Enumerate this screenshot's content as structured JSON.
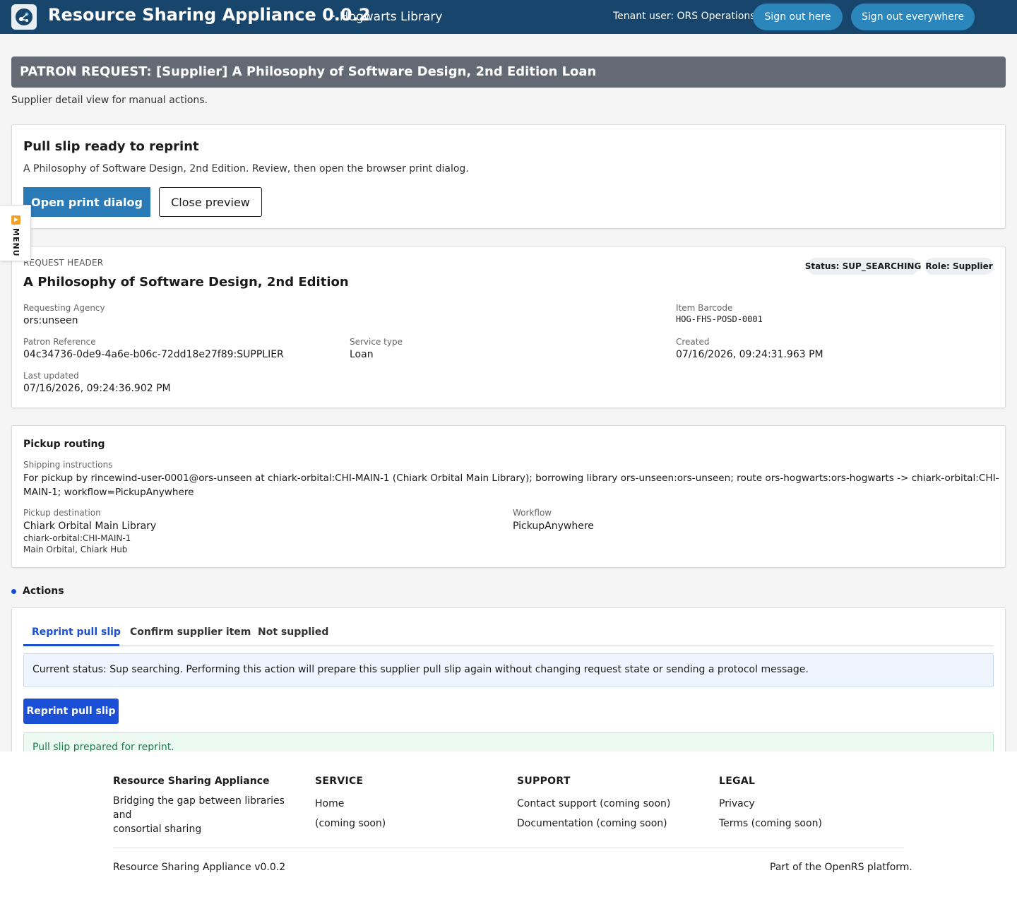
{
  "header": {
    "app_title": "Resource Sharing Appliance 0.0.2",
    "app_subtitle": "· Hogwarts Library",
    "tenant_user": "Tenant user: ORS Operations",
    "sign_out_here": "Sign out here",
    "sign_out_everywhere": "Sign out everywhere",
    "logo_icon": "share-nodes-icon"
  },
  "side_menu": {
    "label": "MENU",
    "icon": "play-icon"
  },
  "page": {
    "title": "PATRON REQUEST: [Supplier] A Philosophy of Software Design, 2nd Edition Loan",
    "subtitle": "Supplier detail view for manual actions."
  },
  "print_card": {
    "heading": "Pull slip ready to reprint",
    "description": "A Philosophy of Software Design, 2nd Edition. Review, then open the browser print dialog.",
    "open_print": "Open print dialog",
    "close_preview": "Close preview"
  },
  "request_header": {
    "kicker": "REQUEST HEADER",
    "title": "A Philosophy of Software Design, 2nd Edition",
    "status_badge": "Status: SUP_SEARCHING",
    "role_badge": "Role: Supplier",
    "requesting_agency_label": "Requesting Agency",
    "requesting_agency": "ors:unseen",
    "item_barcode_label": "Item Barcode",
    "item_barcode": "HOG-FHS-POSD-0001",
    "patron_reference_label": "Patron Reference",
    "patron_reference": "04c34736-0de9-4a6e-b06c-72dd18e27f89:SUPPLIER",
    "service_type_label": "Service type",
    "service_type": "Loan",
    "created_label": "Created",
    "created": "07/16/2026, 09:24:31.963 PM",
    "last_updated_label": "Last updated",
    "last_updated": "07/16/2026, 09:24:36.902 PM"
  },
  "pickup_routing": {
    "heading": "Pickup routing",
    "shipping_label": "Shipping instructions",
    "shipping_line1": "For pickup by rincewind-user-0001@ors-unseen at chiark-orbital:CHI-MAIN-1 (Chiark Orbital Main Library); borrowing library ors-unseen:ors-unseen; route ors-hogwarts:ors-hogwarts -> chiark-orbital:CHI-",
    "shipping_line2": "MAIN-1; workflow=PickupAnywhere",
    "destination_label": "Pickup destination",
    "destination_name": "Chiark Orbital Main Library",
    "destination_code": "chiark-orbital:CHI-MAIN-1",
    "destination_address": "Main Orbital, Chiark Hub",
    "workflow_label": "Workflow",
    "workflow": "PickupAnywhere"
  },
  "actions": {
    "section_label": "Actions",
    "tabs": [
      "Reprint pull slip",
      "Confirm supplier item",
      "Not supplied"
    ],
    "active_tab": "Reprint pull slip",
    "info": "Current status: Sup searching. Performing this action will prepare this supplier pull slip again without changing request state or sending a protocol message.",
    "button": "Reprint pull slip",
    "success": "Pull slip prepared for reprint."
  },
  "footer": {
    "brand": "Resource Sharing Appliance",
    "tagline_1": "Bridging the gap between libraries and",
    "tagline_2": "consortial sharing",
    "service_heading": "SERVICE",
    "service_links": [
      "Home",
      "(coming soon)"
    ],
    "support_heading": "SUPPORT",
    "support_links": [
      "Contact support (coming soon)",
      "Documentation (coming soon)"
    ],
    "legal_heading": "LEGAL",
    "legal_links": [
      "Privacy",
      "Terms (coming soon)"
    ],
    "version": "Resource Sharing Appliance v0.0.2",
    "platform": "Part of the OpenRS platform."
  },
  "colors": {
    "header_bg": "#17456b",
    "header_button": "#2a86bb",
    "title_bar": "#646a73",
    "primary_button": "#2a7ab7",
    "action_blue": "#1a4fd6",
    "success_text": "#217a4a"
  }
}
